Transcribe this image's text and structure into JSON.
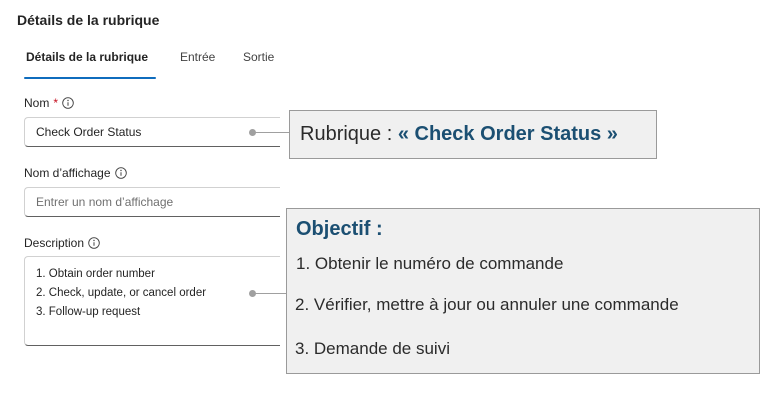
{
  "panel": {
    "title": "Détails de la rubrique"
  },
  "tabs": [
    {
      "label": "Détails de la rubrique",
      "active": true
    },
    {
      "label": "Entrée",
      "active": false
    },
    {
      "label": "Sortie",
      "active": false
    }
  ],
  "fields": {
    "name": {
      "label": "Nom",
      "required_mark": "*",
      "value": "Check Order Status"
    },
    "display_name": {
      "label": "Nom d’affichage",
      "placeholder": "Entrer un nom d’affichage"
    },
    "description": {
      "label": "Description",
      "lines": [
        "1. Obtain order number",
        "2. Check, update, or cancel order",
        "3. Follow-up request"
      ]
    }
  },
  "icons": {
    "info": "info-icon"
  },
  "annotations": {
    "topic": {
      "prefix": "Rubrique : ",
      "highlight": "« Check Order Status »"
    },
    "objective": {
      "title": "Objectif :",
      "lines": [
        "1. Obtenir le numéro de commande",
        "2. Vérifier, mettre à jour ou annuler une commande",
        "3. Demande de suivi"
      ]
    }
  },
  "colors": {
    "accent": "#0f6cbd",
    "required": "#c50f1f",
    "annotation_title": "#1b4f72",
    "annotation_bg": "#f0f0f0"
  }
}
